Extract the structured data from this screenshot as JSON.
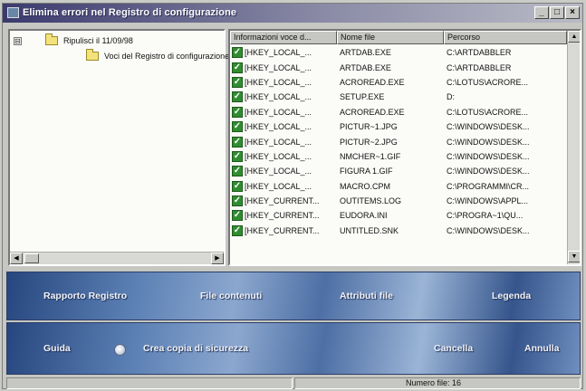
{
  "window": {
    "title": "Elimina errori nel Registro di configurazione",
    "controls": {
      "minimize": "_",
      "maximize": "□",
      "close": "×"
    }
  },
  "tree": {
    "root_expander": "⊟",
    "root_label": "Ripulisci il 11/09/98",
    "child_label": "Voci del Registro di configurazione"
  },
  "list": {
    "columns": [
      "Informazioni voce d...",
      "Nome file",
      "Percorso"
    ],
    "rows": [
      {
        "checked": true,
        "key": "[HKEY_LOCAL_...",
        "file": "ARTDAB.EXE",
        "path": "C:\\ARTDABBLER"
      },
      {
        "checked": true,
        "key": "[HKEY_LOCAL_...",
        "file": "ARTDAB.EXE",
        "path": "C:\\ARTDABBLER"
      },
      {
        "checked": true,
        "key": "[HKEY_LOCAL_...",
        "file": "ACROREAD.EXE",
        "path": "C:\\LOTUS\\ACRORE..."
      },
      {
        "checked": true,
        "key": "[HKEY_LOCAL_...",
        "file": "SETUP.EXE",
        "path": "D:"
      },
      {
        "checked": true,
        "key": "[HKEY_LOCAL_...",
        "file": "ACROREAD.EXE",
        "path": "C:\\LOTUS\\ACRORE..."
      },
      {
        "checked": true,
        "key": "[HKEY_LOCAL_...",
        "file": "PICTUR~1.JPG",
        "path": "C:\\WINDOWS\\DESK..."
      },
      {
        "checked": true,
        "key": "[HKEY_LOCAL_...",
        "file": "PICTUR~2.JPG",
        "path": "C:\\WINDOWS\\DESK..."
      },
      {
        "checked": true,
        "key": "[HKEY_LOCAL_...",
        "file": "NMCHER~1.GIF",
        "path": "C:\\WINDOWS\\DESK..."
      },
      {
        "checked": true,
        "key": "[HKEY_LOCAL_...",
        "file": "FIGURA 1.GIF",
        "path": "C:\\WINDOWS\\DESK..."
      },
      {
        "checked": true,
        "key": "[HKEY_LOCAL_...",
        "file": "MACRO.CPM",
        "path": "C:\\PROGRAMMI\\CR..."
      },
      {
        "checked": true,
        "key": "[HKEY_CURRENT...",
        "file": "OUTITEMS.LOG",
        "path": "C:\\WINDOWS\\APPL..."
      },
      {
        "checked": true,
        "key": "[HKEY_CURRENT...",
        "file": "EUDORA.INI",
        "path": "C:\\PROGRA~1\\QU..."
      },
      {
        "checked": true,
        "key": "[HKEY_CURRENT...",
        "file": "UNTITLED.SNK",
        "path": "C:\\WINDOWS\\DESK..."
      }
    ]
  },
  "actions_top": {
    "registry_report": "Rapporto Registro",
    "file_contents": "File contenuti",
    "file_attributes": "Attributi file",
    "legend": "Legenda"
  },
  "actions_bottom": {
    "help": "Guida",
    "backup": "Crea copia di sicurezza",
    "delete": "Cancella",
    "cancel": "Annulla"
  },
  "status": {
    "file_count": "Numero file: 16"
  },
  "colors": {
    "title_gradient_start": "#3b3a6e",
    "panel_blue": "#4d6fa4",
    "check_green": "#2f8d2f"
  },
  "icons": {
    "tree_folder": "folder-icon",
    "row_check": "check-icon",
    "backup_radio": "radio-icon"
  }
}
